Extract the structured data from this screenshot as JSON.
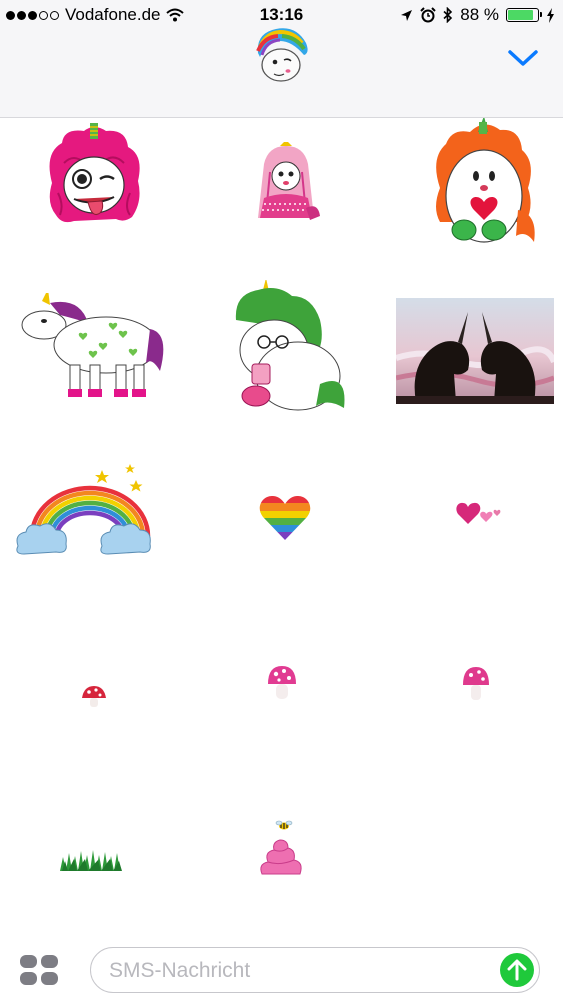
{
  "status_bar": {
    "carrier": "Vodafone.de",
    "time": "13:16",
    "battery_text": "88 %",
    "battery_level": 0.88,
    "icons": [
      "signal-dots-icon",
      "wifi-icon",
      "location-arrow-icon",
      "alarm-clock-icon",
      "bluetooth-icon",
      "battery-icon",
      "charging-bolt-icon"
    ]
  },
  "header": {
    "app_icon": "rainbow-unicorn-avatar-icon",
    "collapse_icon": "chevron-down-icon"
  },
  "stickers": [
    {
      "name": "pink-hair-unicorn-tongue"
    },
    {
      "name": "princess-unicorn-pink-dress"
    },
    {
      "name": "orange-hair-unicorn-heart"
    },
    {
      "name": "purple-mane-unicorn-pony"
    },
    {
      "name": "green-mane-unicorn-sitting"
    },
    {
      "name": "two-black-unicorns-photo"
    },
    {
      "name": "rainbow-with-clouds"
    },
    {
      "name": "rainbow-heart"
    },
    {
      "name": "small-pink-hearts"
    },
    {
      "name": "small-red-mushroom"
    },
    {
      "name": "pink-mushroom"
    },
    {
      "name": "pink-mushroom-right"
    },
    {
      "name": "grass-patch"
    },
    {
      "name": "pink-poop-with-bee"
    }
  ],
  "composer": {
    "apps_icon": "app-drawer-icon",
    "placeholder": "SMS-Nachricht",
    "value": "",
    "send_icon": "send-arrow-up-icon"
  },
  "colors": {
    "accent_blue": "#0a7aff",
    "send_green": "#1fc93b",
    "battery_green": "#4cd964"
  }
}
